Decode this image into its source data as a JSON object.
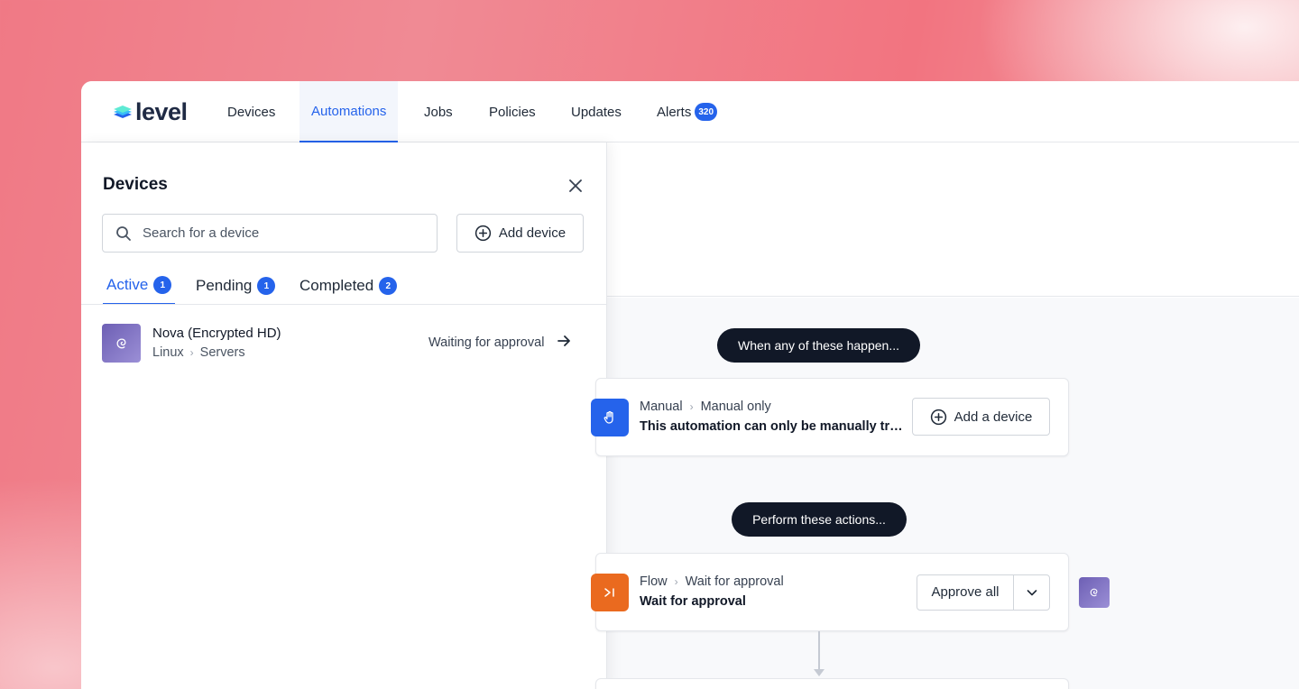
{
  "nav": {
    "logo_text": "level",
    "items": [
      {
        "label": "Devices"
      },
      {
        "label": "Automations"
      },
      {
        "label": "Jobs"
      },
      {
        "label": "Policies"
      },
      {
        "label": "Updates"
      },
      {
        "label": "Alerts",
        "badge": "320"
      }
    ],
    "active": "Automations"
  },
  "panel": {
    "title": "Devices",
    "search": {
      "placeholder": "Search for a device",
      "value": ""
    },
    "add_button": "Add device",
    "tabs": [
      {
        "label": "Active",
        "count": "1"
      },
      {
        "label": "Pending",
        "count": "1"
      },
      {
        "label": "Completed",
        "count": "2"
      }
    ],
    "devices": [
      {
        "name": "Nova (Encrypted HD)",
        "path": [
          "Linux",
          "Servers"
        ],
        "status": "Waiting for approval",
        "icon": "debian-icon"
      }
    ]
  },
  "workflow": {
    "trigger_pill": "When any of these happen...",
    "trigger": {
      "crumb": [
        "Manual",
        "Manual only"
      ],
      "title": "This automation can only be manually trig...",
      "button": "Add a device",
      "icon_color": "#2563eb"
    },
    "actions_pill": "Perform these actions...",
    "action": {
      "crumb": [
        "Flow",
        "Wait for approval"
      ],
      "title": "Wait for approval",
      "button": "Approve all",
      "icon_color": "#ea6a1f"
    }
  },
  "colors": {
    "accent": "#2563eb",
    "pill": "#111827",
    "avatar": "#7a6cc4"
  }
}
